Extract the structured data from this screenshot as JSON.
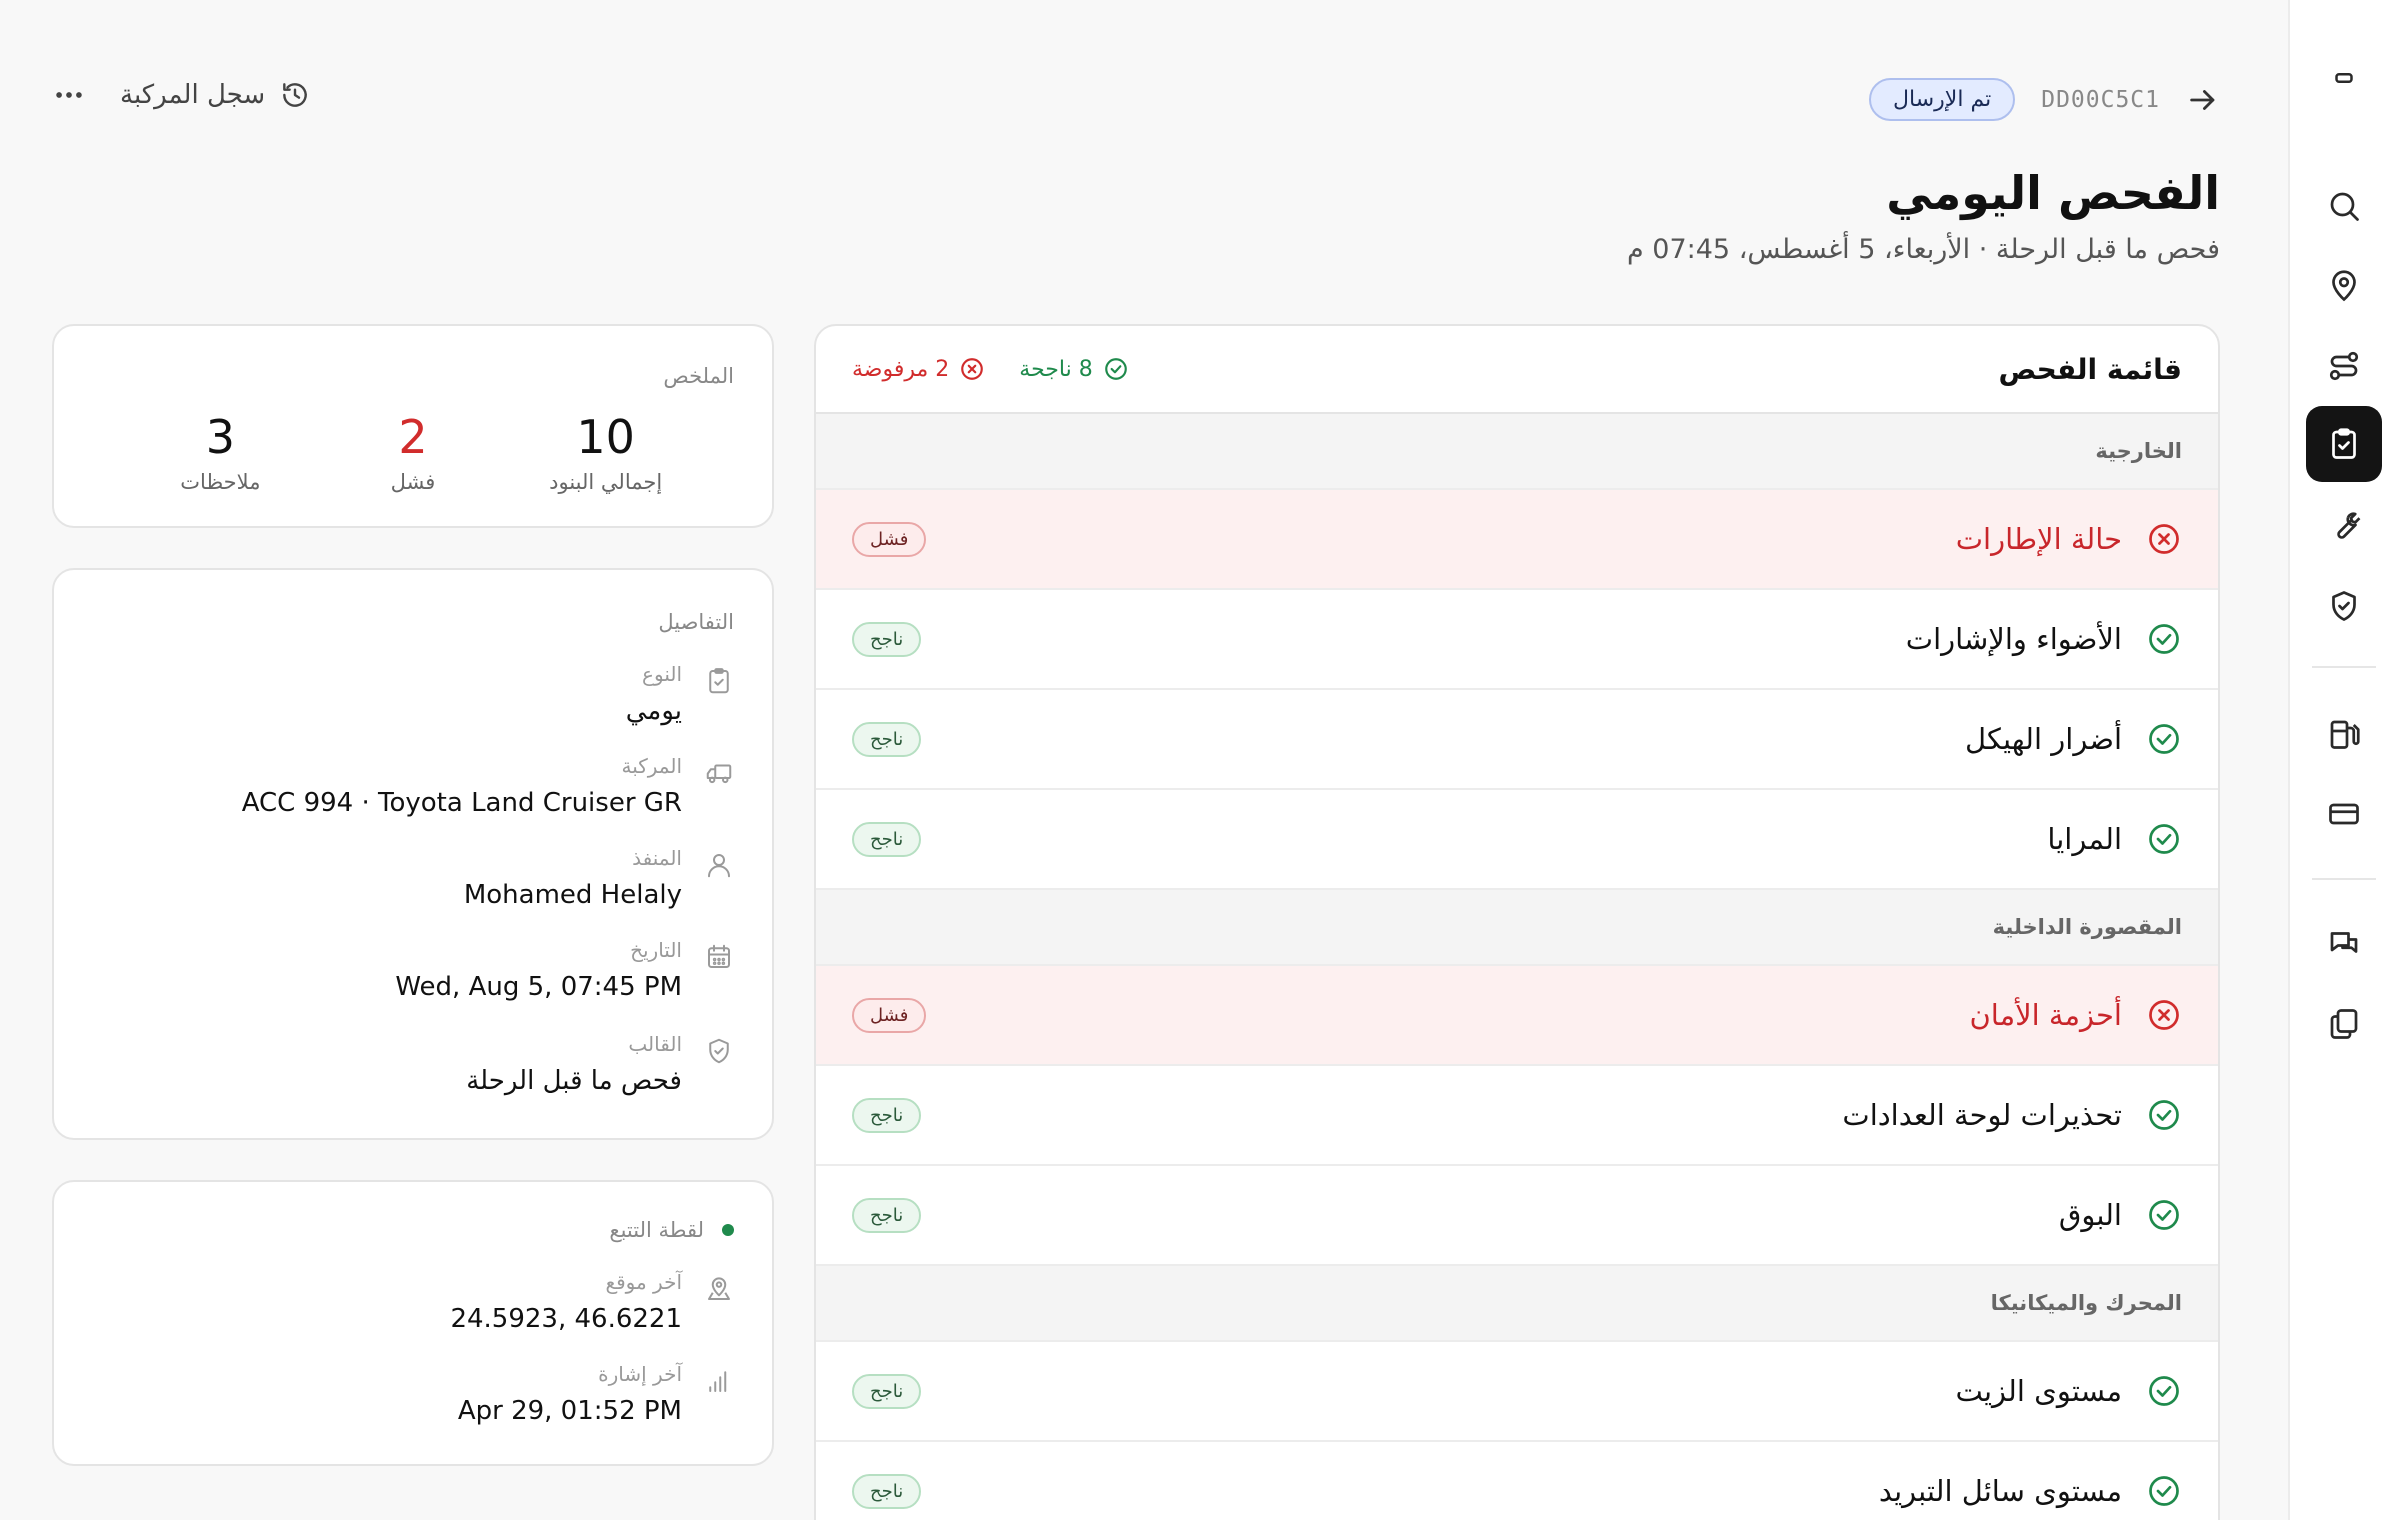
{
  "header": {
    "ref_code": "DD00C5C1",
    "status": "تم الإرسال",
    "history_label": "سجل المركبة",
    "title": "الفحص اليومي",
    "subtitle": "فحص ما قبل الرحلة · الأربعاء، 5 أغسطس، 07:45 م"
  },
  "checklist": {
    "title": "قائمة الفحص",
    "passed_count": "8 ناجحة",
    "failed_count": "2 مرفوضة",
    "pass_badge": "ناجح",
    "fail_badge": "فشل",
    "sections": [
      {
        "title": "الخارجية",
        "items": [
          {
            "label": "حالة الإطارات",
            "status": "fail"
          },
          {
            "label": "الأضواء والإشارات",
            "status": "pass"
          },
          {
            "label": "أضرار الهيكل",
            "status": "pass"
          },
          {
            "label": "المرايا",
            "status": "pass"
          }
        ]
      },
      {
        "title": "المقصورة الداخلية",
        "items": [
          {
            "label": "أحزمة الأمان",
            "status": "fail"
          },
          {
            "label": "تحذيرات لوحة العدادات",
            "status": "pass"
          },
          {
            "label": "البوق",
            "status": "pass"
          }
        ]
      },
      {
        "title": "المحرك والميكانيكا",
        "items": [
          {
            "label": "مستوى الزيت",
            "status": "pass"
          },
          {
            "label": "مستوى سائل التبريد",
            "status": "pass"
          }
        ]
      }
    ]
  },
  "summary": {
    "label": "الملخص",
    "total_value": "10",
    "total_label": "إجمالي البنود",
    "fail_value": "2",
    "fail_label": "فشل",
    "notes_value": "3",
    "notes_label": "ملاحظات"
  },
  "details": {
    "label": "التفاصيل",
    "type_key": "النوع",
    "type_val": "يومي",
    "vehicle_key": "المركبة",
    "vehicle_val": "ACC 994 · Toyota Land Cruiser GR",
    "inspector_key": "المنفذ",
    "inspector_val": "Mohamed Helaly",
    "date_key": "التاريخ",
    "date_val": "Wed, Aug 5, 07:45 PM",
    "template_key": "القالب",
    "template_val": "فحص ما قبل الرحلة"
  },
  "tracking": {
    "label": "لقطة التتبع",
    "location_key": "آخر موقع",
    "location_val": "24.5923, 46.6221",
    "signal_key": "آخر إشارة",
    "signal_val": "Apr 29, 01:52 PM"
  },
  "colors": {
    "pass": "#1f8a4c",
    "fail": "#d12c2c",
    "status_pill_bg": "#e3ebff",
    "active_rail": "#141414"
  }
}
